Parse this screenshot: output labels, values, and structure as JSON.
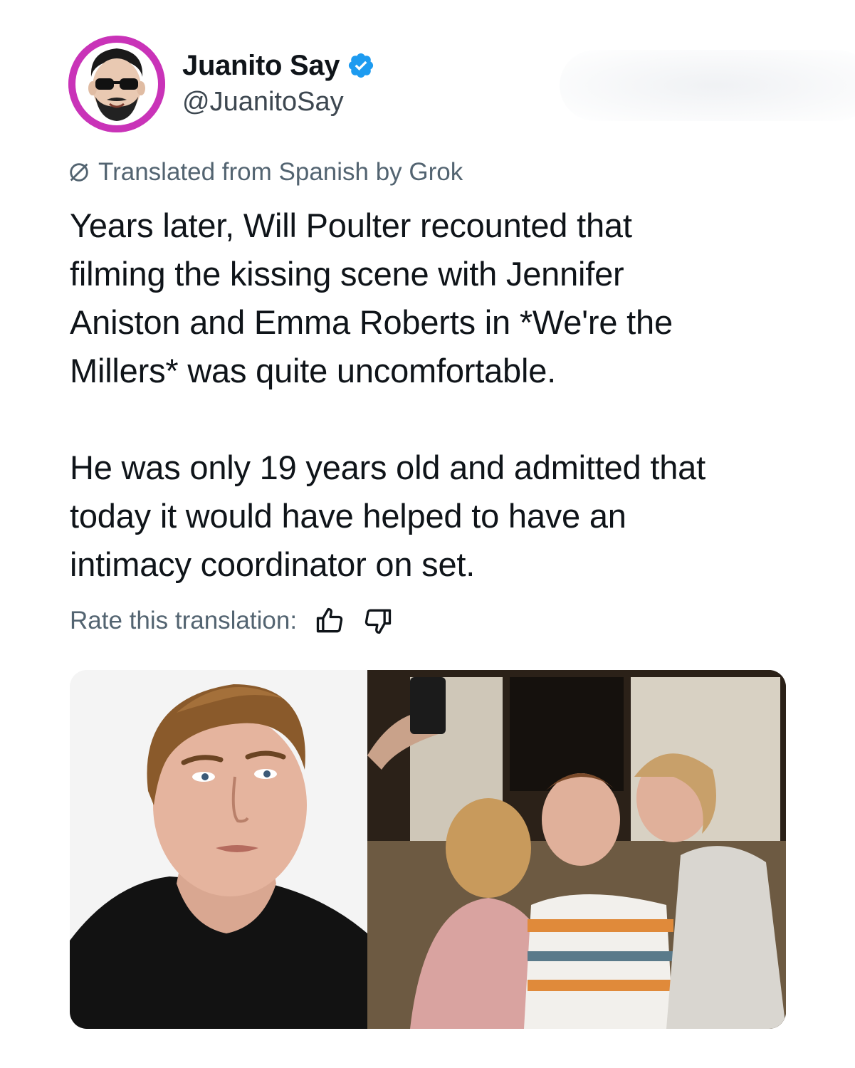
{
  "author": {
    "display_name": "Juanito Say",
    "handle": "@JuanitoSay",
    "verified": true,
    "avatar_icon": "cartoon-avatar-icon"
  },
  "translation": {
    "notice": "Translated from Spanish by Grok",
    "notice_icon": "globe-slash-icon"
  },
  "post": {
    "text": "Years later, Will Poulter recounted that\nfilming the kissing scene with Jennifer\nAniston and Emma Roberts in *We're the\nMillers* was quite uncomfortable.\n\nHe was only 19 years old and admitted that\ntoday it would have helped to have an\nintimacy coordinator on set."
  },
  "rate": {
    "label": "Rate this translation:",
    "thumbs_up_icon": "thumbs-up-icon",
    "thumbs_down_icon": "thumbs-down-icon"
  },
  "media": {
    "left_photo_icon": "portrait-photo",
    "right_photo_icon": "movie-still-photo"
  },
  "colors": {
    "avatar_ring": "#c933b8",
    "verified_blue": "#1d9bf0",
    "secondary_text": "#536471"
  }
}
